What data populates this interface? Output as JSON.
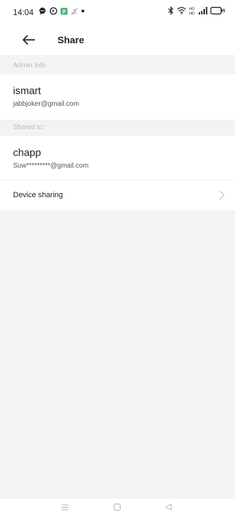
{
  "status_bar": {
    "time": "14:04",
    "left_icons": [
      "chat-icon",
      "alarm-icon",
      "app-notification-icon",
      "signal-app-icon",
      "dot-icon"
    ],
    "right_icons": [
      "bluetooth-icon",
      "wifi-icon",
      "dual-sim-icon",
      "signal-icon",
      "battery-charging-icon"
    ]
  },
  "header": {
    "back_icon": "arrow-left-icon",
    "title": "Share"
  },
  "admin_section": {
    "label": "Admin Info",
    "name": "ismart",
    "email": "jabbjoker@gmail.com"
  },
  "shared_section": {
    "label": "Shared to:",
    "name": "chapp",
    "email": "Suw*********@gmail.com"
  },
  "device_sharing": {
    "label": "Device sharing",
    "icon": "chevron-right-icon"
  },
  "nav_bar": {
    "buttons": [
      "menu-icon",
      "home-icon",
      "back-triangle-icon"
    ]
  },
  "colors": {
    "background": "#f3f3f4",
    "card": "#ffffff",
    "section_label": "#b9b9bf",
    "text_primary": "#222222",
    "text_secondary": "#555555",
    "chevron": "#c8c8cc",
    "nav_icon": "#b0b0b4"
  }
}
